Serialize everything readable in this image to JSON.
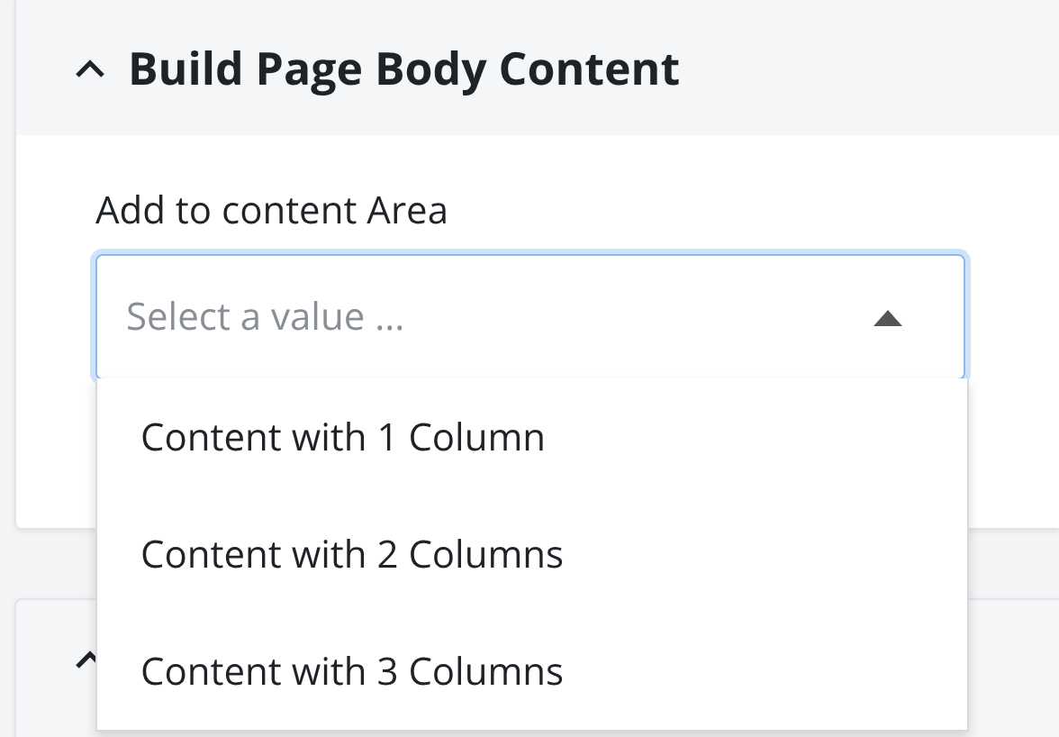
{
  "panel": {
    "title": "Build Page Body Content",
    "expanded": true
  },
  "field": {
    "label": "Add to content Area",
    "placeholder": "Select a value ...",
    "open": true
  },
  "options": [
    {
      "label": "Content with 1 Column"
    },
    {
      "label": "Content with 2 Columns"
    },
    {
      "label": "Content with 3 Columns"
    }
  ],
  "second_panel": {
    "expanded": true
  }
}
